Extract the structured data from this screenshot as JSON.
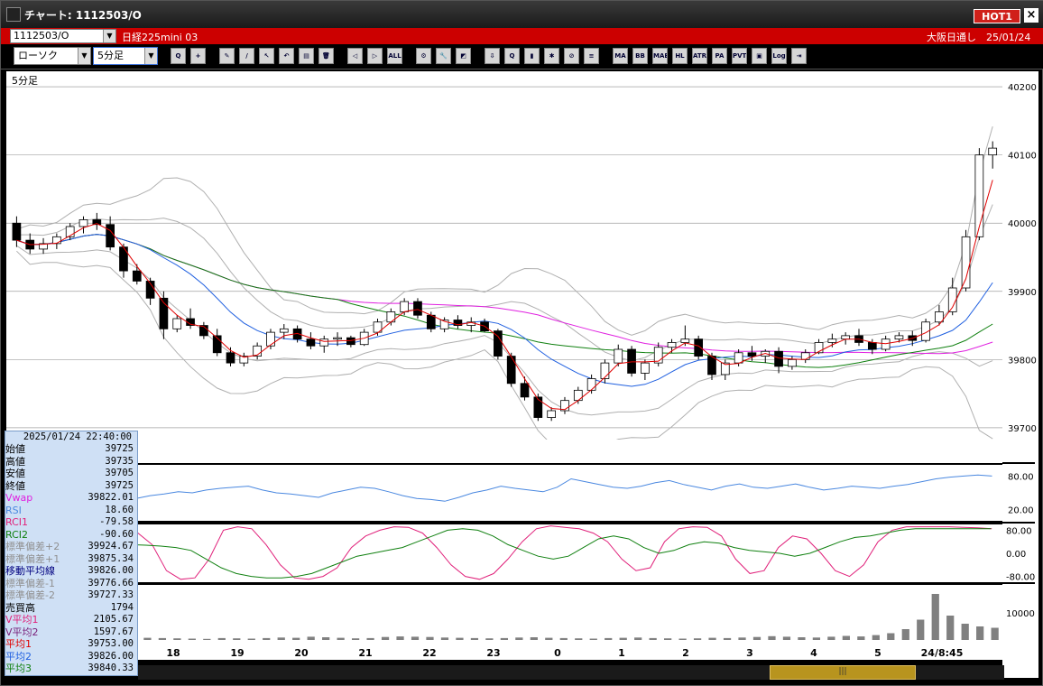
{
  "window": {
    "title": "チャート: 1112503/O",
    "hot_label": "HOT1",
    "close_glyph": "×"
  },
  "symbol": {
    "code": "1112503/O",
    "name": "日経225mini 03",
    "market": "大阪日通し　25/01/24"
  },
  "toolbar": {
    "chart_type": "ローソク",
    "timeframe": "5分足",
    "buttons": [
      {
        "name": "zoom-icon",
        "label": "Q"
      },
      {
        "name": "crosshair-icon",
        "label": "+"
      },
      {
        "name": "pencil-icon",
        "label": "✎"
      },
      {
        "name": "line-tool-icon",
        "label": "/"
      },
      {
        "name": "pointer-icon",
        "label": "↖"
      },
      {
        "name": "undo-icon",
        "label": "↶"
      },
      {
        "name": "document-icon",
        "label": "▤"
      },
      {
        "name": "trash-icon",
        "label": "🗑"
      },
      {
        "name": "candle-left-icon",
        "label": "◁"
      },
      {
        "name": "candle-right-icon",
        "label": "▷"
      },
      {
        "name": "all-button",
        "label": "ALL"
      },
      {
        "name": "settings-icon",
        "label": "⚙"
      },
      {
        "name": "wrench-icon",
        "label": "🔧"
      },
      {
        "name": "color-icon",
        "label": "◩"
      },
      {
        "name": "download-icon",
        "label": "⇩"
      },
      {
        "name": "search-icon",
        "label": "Q"
      },
      {
        "name": "bar-icon",
        "label": "▮"
      },
      {
        "name": "cross-icon",
        "label": "✱"
      },
      {
        "name": "clock-icon",
        "label": "⊘"
      },
      {
        "name": "indicator-icon",
        "label": "≡"
      },
      {
        "name": "ma-button",
        "label": "MA"
      },
      {
        "name": "bb-button",
        "label": "BB"
      },
      {
        "name": "mae-button",
        "label": "MAE"
      },
      {
        "name": "hl-button",
        "label": "HL"
      },
      {
        "name": "atr-button",
        "label": "ATR"
      },
      {
        "name": "para-button",
        "label": "PA"
      },
      {
        "name": "pvt-button",
        "label": "PVT"
      },
      {
        "name": "frame-icon",
        "label": "▣"
      },
      {
        "name": "log-button",
        "label": "Log"
      },
      {
        "name": "export-icon",
        "label": "⇥"
      }
    ]
  },
  "chart_data": [
    {
      "type": "candlestick",
      "title": "5分足",
      "ylim": [
        39680,
        40220
      ],
      "yticks": [
        39700,
        39800,
        39900,
        40000,
        40100,
        40200
      ],
      "xticks": [
        "18",
        "19",
        "20",
        "21",
        "22",
        "23",
        "0",
        "1",
        "2",
        "3",
        "4",
        "5",
        "24/8:45"
      ],
      "series": [
        {
          "name": "ローソク",
          "ohlc": [
            [
              40000,
              40010,
              39965,
              39975
            ],
            [
              39975,
              39985,
              39955,
              39962
            ],
            [
              39962,
              39978,
              39955,
              39970
            ],
            [
              39970,
              39985,
              39962,
              39980
            ],
            [
              39980,
              40000,
              39975,
              39995
            ],
            [
              39995,
              40010,
              39985,
              40005
            ],
            [
              40005,
              40015,
              39990,
              39998
            ],
            [
              39998,
              40010,
              39960,
              39965
            ],
            [
              39965,
              39970,
              39920,
              39930
            ],
            [
              39930,
              39940,
              39910,
              39915
            ],
            [
              39915,
              39920,
              39880,
              39890
            ],
            [
              39890,
              39900,
              39830,
              39845
            ],
            [
              39845,
              39865,
              39840,
              39860
            ],
            [
              39860,
              39875,
              39845,
              39850
            ],
            [
              39850,
              39855,
              39830,
              39835
            ],
            [
              39835,
              39845,
              39805,
              39810
            ],
            [
              39810,
              39818,
              39790,
              39795
            ],
            [
              39795,
              39810,
              39790,
              39805
            ],
            [
              39805,
              39825,
              39800,
              39820
            ],
            [
              39820,
              39845,
              39815,
              39840
            ],
            [
              39840,
              39852,
              39830,
              39845
            ],
            [
              39845,
              39850,
              39825,
              39830
            ],
            [
              39830,
              39840,
              39815,
              39820
            ],
            [
              39820,
              39835,
              39810,
              39830
            ],
            [
              39830,
              39840,
              39820,
              39832
            ],
            [
              39832,
              39835,
              39818,
              39822
            ],
            [
              39822,
              39845,
              39820,
              39840
            ],
            [
              39840,
              39860,
              39835,
              39855
            ],
            [
              39855,
              39875,
              39850,
              39870
            ],
            [
              39870,
              39890,
              39865,
              39885
            ],
            [
              39885,
              39890,
              39860,
              39865
            ],
            [
              39865,
              39870,
              39840,
              39845
            ],
            [
              39845,
              39862,
              39840,
              39858
            ],
            [
              39858,
              39865,
              39845,
              39850
            ],
            [
              39850,
              39862,
              39840,
              39855
            ],
            [
              39855,
              39860,
              39840,
              39842
            ],
            [
              39842,
              39845,
              39800,
              39805
            ],
            [
              39805,
              39810,
              39760,
              39765
            ],
            [
              39765,
              39775,
              39740,
              39745
            ],
            [
              39745,
              39750,
              39710,
              39715
            ],
            [
              39715,
              39730,
              39710,
              39725
            ],
            [
              39725,
              39745,
              39720,
              39740
            ],
            [
              39740,
              39760,
              39735,
              39755
            ],
            [
              39755,
              39778,
              39750,
              39772
            ],
            [
              39772,
              39800,
              39765,
              39795
            ],
            [
              39795,
              39822,
              39790,
              39815
            ],
            [
              39815,
              39820,
              39775,
              39780
            ],
            [
              39780,
              39800,
              39770,
              39795
            ],
            [
              39795,
              39825,
              39790,
              39818
            ],
            [
              39818,
              39830,
              39810,
              39825
            ],
            [
              39825,
              39850,
              39820,
              39830
            ],
            [
              39830,
              39835,
              39800,
              39805
            ],
            [
              39805,
              39810,
              39770,
              39778
            ],
            [
              39778,
              39800,
              39770,
              39795
            ],
            [
              39795,
              39815,
              39790,
              39810
            ],
            [
              39810,
              39820,
              39798,
              39805
            ],
            [
              39805,
              39815,
              39795,
              39812
            ],
            [
              39812,
              39818,
              39780,
              39790
            ],
            [
              39790,
              39805,
              39785,
              39800
            ],
            [
              39800,
              39815,
              39795,
              39810
            ],
            [
              39810,
              39830,
              39808,
              39825
            ],
            [
              39825,
              39838,
              39818,
              39830
            ],
            [
              39830,
              39840,
              39822,
              39835
            ],
            [
              39835,
              39845,
              39820,
              39825
            ],
            [
              39825,
              39830,
              39808,
              39815
            ],
            [
              39815,
              39835,
              39812,
              39830
            ],
            [
              39830,
              39840,
              39825,
              39835
            ],
            [
              39835,
              39842,
              39820,
              39828
            ],
            [
              39828,
              39860,
              39825,
              39855
            ],
            [
              39855,
              39880,
              39850,
              39870
            ],
            [
              39870,
              39920,
              39865,
              39905
            ],
            [
              39905,
              39990,
              39900,
              39980
            ],
            [
              39980,
              40110,
              39975,
              40100
            ],
            [
              40100,
              40120,
              40080,
              40110
            ]
          ]
        }
      ],
      "legend": {
        "datetime": "2025/01/24 22:40:00",
        "rows": [
          {
            "label": "始値",
            "value": "39725",
            "color": "#000000"
          },
          {
            "label": "高値",
            "value": "39735",
            "color": "#000000"
          },
          {
            "label": "安値",
            "value": "39705",
            "color": "#000000"
          },
          {
            "label": "終値",
            "value": "39725",
            "color": "#000000"
          },
          {
            "label": "Vwap",
            "value": "39822.01",
            "color": "#e020e0"
          },
          {
            "label": "RSI",
            "value": "18.60",
            "color": "#4a88e0"
          },
          {
            "label": "RCI1",
            "value": "-79.58",
            "color": "#e0207a"
          },
          {
            "label": "RCI2",
            "value": "-90.60",
            "color": "#108010"
          },
          {
            "label": "標準偏差+2",
            "value": "39924.67",
            "color": "#909090"
          },
          {
            "label": "標準偏差+1",
            "value": "39875.34",
            "color": "#909090"
          },
          {
            "label": "移動平均線",
            "value": "39826.00",
            "color": "#000080"
          },
          {
            "label": "標準偏差-1",
            "value": "39776.66",
            "color": "#909090"
          },
          {
            "label": "標準偏差-2",
            "value": "39727.33",
            "color": "#909090"
          },
          {
            "label": "売買高",
            "value": "1794",
            "color": "#000000"
          },
          {
            "label": "V平均1",
            "value": "2105.67",
            "color": "#e0207a"
          },
          {
            "label": "V平均2",
            "value": "1597.67",
            "color": "#7a207a"
          },
          {
            "label": "平均1",
            "value": "39753.00",
            "color": "#e00000"
          },
          {
            "label": "平均2",
            "value": "39826.00",
            "color": "#2060e0"
          },
          {
            "label": "平均3",
            "value": "39840.33",
            "color": "#108010"
          }
        ]
      }
    },
    {
      "type": "line",
      "title": "RSI",
      "ylim": [
        0,
        100
      ],
      "yticks": [
        20,
        80
      ],
      "series": [
        {
          "name": "RSI",
          "values": [
            62,
            55,
            58,
            50,
            48,
            40,
            28,
            25,
            30,
            40,
            45,
            48,
            52,
            50,
            55,
            58,
            60,
            62,
            55,
            50,
            48,
            45,
            42,
            50,
            55,
            60,
            58,
            52,
            45,
            40,
            38,
            35,
            42,
            50,
            55,
            62,
            58,
            55,
            52,
            60,
            75,
            70,
            65,
            60,
            58,
            62,
            68,
            72,
            65,
            60,
            55,
            62,
            66,
            60,
            58,
            62,
            66,
            60,
            55,
            58,
            62,
            60,
            58,
            62,
            65,
            70,
            75,
            78,
            80,
            82,
            80
          ]
        }
      ]
    },
    {
      "type": "line",
      "title": "RCI",
      "ylim": [
        -100,
        100
      ],
      "yticks": [
        80,
        0,
        -80
      ],
      "series": [
        {
          "name": "RCI1",
          "values": [
            -80,
            -75,
            -60,
            60,
            92,
            88,
            40,
            -20,
            50,
            70,
            30,
            -60,
            -90,
            -85,
            -20,
            80,
            92,
            85,
            30,
            -40,
            -85,
            -90,
            -80,
            -50,
            20,
            60,
            80,
            92,
            90,
            70,
            20,
            -40,
            -80,
            -90,
            -70,
            -20,
            40,
            85,
            95,
            90,
            85,
            70,
            40,
            -20,
            -60,
            -50,
            40,
            85,
            92,
            90,
            60,
            -20,
            -70,
            -60,
            20,
            60,
            50,
            0,
            -60,
            -80,
            -40,
            40,
            80,
            92,
            92,
            92,
            92,
            90,
            88,
            85
          ]
        },
        {
          "name": "RCI2",
          "values": [
            -80,
            -90,
            -88,
            -80,
            -60,
            -30,
            0,
            20,
            30,
            28,
            25,
            20,
            10,
            -20,
            -50,
            -70,
            -80,
            -85,
            -85,
            -80,
            -70,
            -50,
            -30,
            -10,
            0,
            10,
            20,
            40,
            60,
            80,
            85,
            80,
            60,
            30,
            10,
            -10,
            -20,
            -10,
            20,
            50,
            60,
            50,
            20,
            0,
            10,
            30,
            40,
            35,
            20,
            10,
            5,
            0,
            -10,
            0,
            20,
            40,
            55,
            60,
            70,
            80,
            85,
            85,
            85,
            85,
            85,
            85
          ]
        }
      ]
    },
    {
      "type": "bar",
      "title": "売買高",
      "yticks": [
        10000
      ],
      "series": [
        {
          "name": "売買高",
          "values": [
            1500,
            1200,
            900,
            800,
            700,
            600,
            500,
            600,
            900,
            800,
            700,
            600,
            500,
            400,
            700,
            600,
            500,
            700,
            900,
            800,
            1200,
            1000,
            800,
            600,
            700,
            1100,
            1300,
            1200,
            1100,
            900,
            800,
            700,
            600,
            700,
            900,
            1000,
            800,
            700,
            600,
            500,
            700,
            800,
            900,
            700,
            600,
            500,
            600,
            800,
            700,
            900,
            1100,
            1400,
            1200,
            1000,
            900,
            1200,
            1500,
            1300,
            1800,
            2500,
            4000,
            7500,
            17000,
            9000,
            6000,
            5000,
            4500
          ]
        }
      ]
    }
  ],
  "colors": {
    "up": "#ffffff",
    "down": "#000000",
    "ma1": "#e00000",
    "ma2": "#2060e0",
    "ma3": "#108010",
    "vwap": "#e020e0",
    "bb": "#b0b0b0"
  }
}
